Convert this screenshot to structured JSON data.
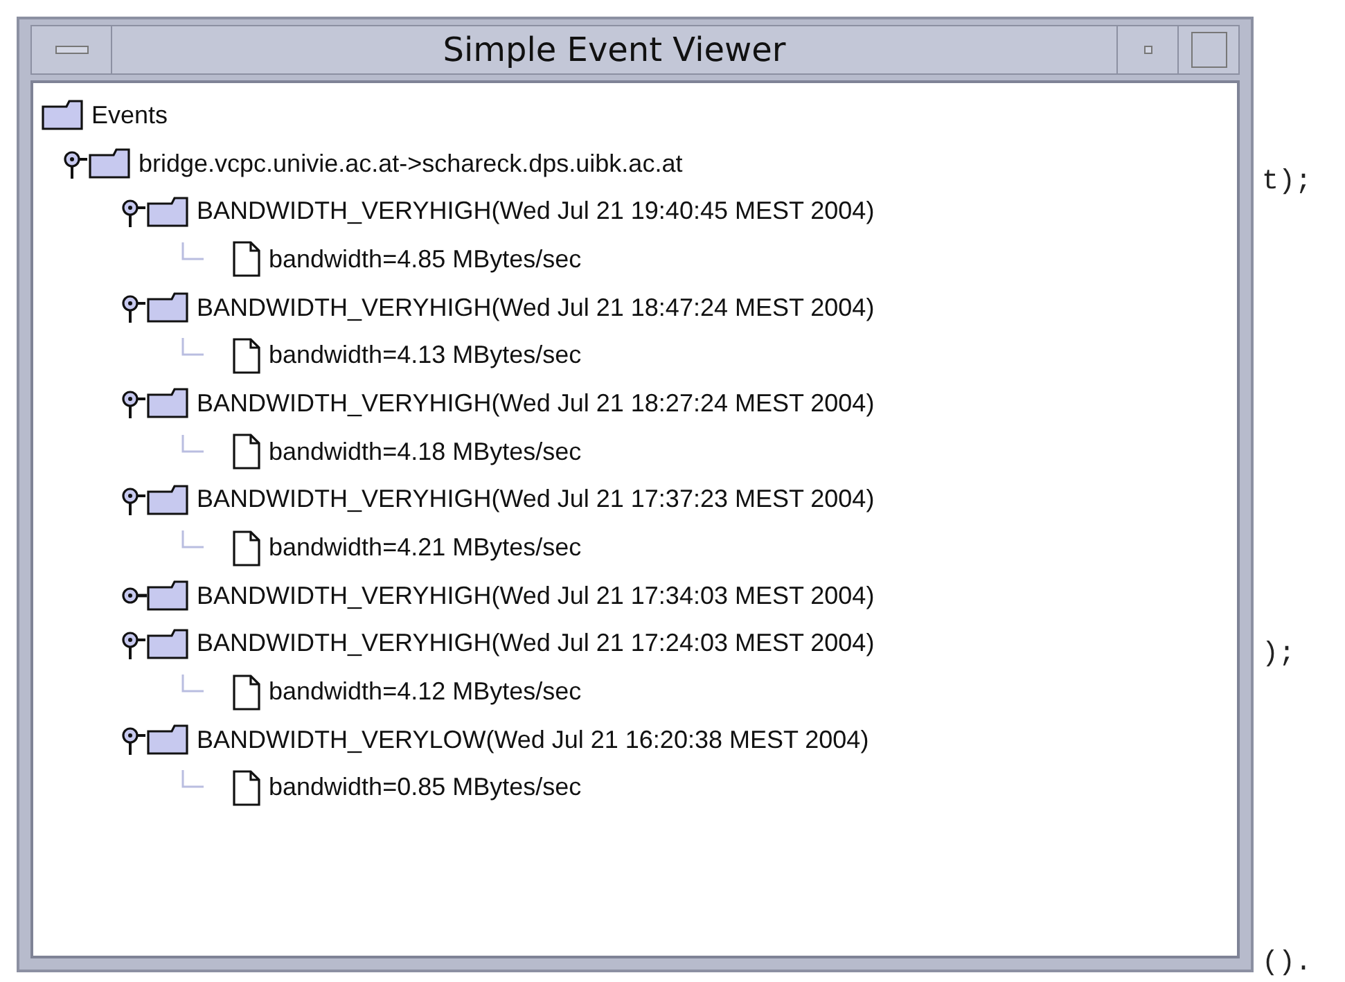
{
  "window": {
    "title": "Simple Event Viewer"
  },
  "tree": [
    {
      "label": "Events",
      "kind": "folder",
      "children": [
        {
          "label": "bridge.vcpc.univie.ac.at->schareck.dps.uibk.ac.at",
          "kind": "folder",
          "expanded": true,
          "children": [
            {
              "label": "BANDWIDTH_VERYHIGH(Wed Jul 21 19:40:45 MEST 2004)",
              "kind": "folder",
              "expanded": true,
              "children": [
                {
                  "label": "bandwidth=4.85 MBytes/sec",
                  "kind": "file"
                }
              ]
            },
            {
              "label": "BANDWIDTH_VERYHIGH(Wed Jul 21 18:47:24 MEST 2004)",
              "kind": "folder",
              "expanded": true,
              "children": [
                {
                  "label": "bandwidth=4.13 MBytes/sec",
                  "kind": "file"
                }
              ]
            },
            {
              "label": "BANDWIDTH_VERYHIGH(Wed Jul 21 18:27:24 MEST 2004)",
              "kind": "folder",
              "expanded": true,
              "children": [
                {
                  "label": "bandwidth=4.18 MBytes/sec",
                  "kind": "file"
                }
              ]
            },
            {
              "label": "BANDWIDTH_VERYHIGH(Wed Jul 21 17:37:23 MEST 2004)",
              "kind": "folder",
              "expanded": true,
              "children": [
                {
                  "label": "bandwidth=4.21 MBytes/sec",
                  "kind": "file"
                }
              ]
            },
            {
              "label": "BANDWIDTH_VERYHIGH(Wed Jul 21 17:34:03 MEST 2004)",
              "kind": "folder",
              "expanded": false
            },
            {
              "label": "BANDWIDTH_VERYHIGH(Wed Jul 21 17:24:03 MEST 2004)",
              "kind": "folder",
              "expanded": true,
              "children": [
                {
                  "label": "bandwidth=4.12 MBytes/sec",
                  "kind": "file"
                }
              ]
            },
            {
              "label": "BANDWIDTH_VERYLOW(Wed Jul 21 16:20:38 MEST 2004)",
              "kind": "folder",
              "expanded": true,
              "children": [
                {
                  "label": "bandwidth=0.85 MBytes/sec",
                  "kind": "file"
                }
              ]
            }
          ]
        }
      ]
    }
  ],
  "background_code": [
    "t);",
    ");",
    "()."
  ]
}
